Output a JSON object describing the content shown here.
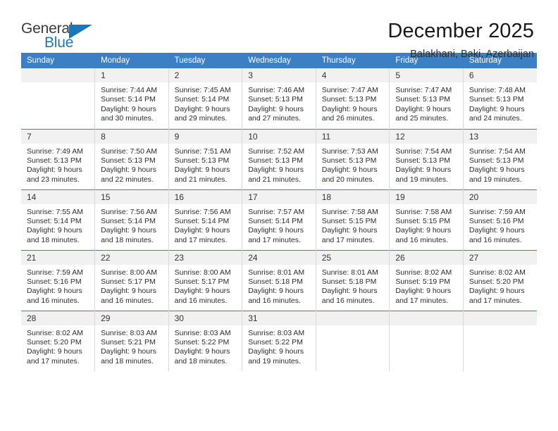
{
  "brand": {
    "name_part1": "General",
    "name_part2": "Blue",
    "logo_icon": "triangle-flag-icon",
    "accent_color": "#1b76bc"
  },
  "header": {
    "month_title": "December 2025",
    "location": "Balakhani, Baki, Azerbaijan"
  },
  "calendar": {
    "header_background": "#3b7fc4",
    "daynum_background": "#f1f1f1",
    "weekday_headers": [
      "Sunday",
      "Monday",
      "Tuesday",
      "Wednesday",
      "Thursday",
      "Friday",
      "Saturday"
    ],
    "weeks": [
      [
        {
          "day": "",
          "sunrise": "",
          "sunset": "",
          "daylight_line1": "",
          "daylight_line2": ""
        },
        {
          "day": "1",
          "sunrise": "Sunrise: 7:44 AM",
          "sunset": "Sunset: 5:14 PM",
          "daylight_line1": "Daylight: 9 hours",
          "daylight_line2": "and 30 minutes."
        },
        {
          "day": "2",
          "sunrise": "Sunrise: 7:45 AM",
          "sunset": "Sunset: 5:14 PM",
          "daylight_line1": "Daylight: 9 hours",
          "daylight_line2": "and 29 minutes."
        },
        {
          "day": "3",
          "sunrise": "Sunrise: 7:46 AM",
          "sunset": "Sunset: 5:13 PM",
          "daylight_line1": "Daylight: 9 hours",
          "daylight_line2": "and 27 minutes."
        },
        {
          "day": "4",
          "sunrise": "Sunrise: 7:47 AM",
          "sunset": "Sunset: 5:13 PM",
          "daylight_line1": "Daylight: 9 hours",
          "daylight_line2": "and 26 minutes."
        },
        {
          "day": "5",
          "sunrise": "Sunrise: 7:47 AM",
          "sunset": "Sunset: 5:13 PM",
          "daylight_line1": "Daylight: 9 hours",
          "daylight_line2": "and 25 minutes."
        },
        {
          "day": "6",
          "sunrise": "Sunrise: 7:48 AM",
          "sunset": "Sunset: 5:13 PM",
          "daylight_line1": "Daylight: 9 hours",
          "daylight_line2": "and 24 minutes."
        }
      ],
      [
        {
          "day": "7",
          "sunrise": "Sunrise: 7:49 AM",
          "sunset": "Sunset: 5:13 PM",
          "daylight_line1": "Daylight: 9 hours",
          "daylight_line2": "and 23 minutes."
        },
        {
          "day": "8",
          "sunrise": "Sunrise: 7:50 AM",
          "sunset": "Sunset: 5:13 PM",
          "daylight_line1": "Daylight: 9 hours",
          "daylight_line2": "and 22 minutes."
        },
        {
          "day": "9",
          "sunrise": "Sunrise: 7:51 AM",
          "sunset": "Sunset: 5:13 PM",
          "daylight_line1": "Daylight: 9 hours",
          "daylight_line2": "and 21 minutes."
        },
        {
          "day": "10",
          "sunrise": "Sunrise: 7:52 AM",
          "sunset": "Sunset: 5:13 PM",
          "daylight_line1": "Daylight: 9 hours",
          "daylight_line2": "and 21 minutes."
        },
        {
          "day": "11",
          "sunrise": "Sunrise: 7:53 AM",
          "sunset": "Sunset: 5:13 PM",
          "daylight_line1": "Daylight: 9 hours",
          "daylight_line2": "and 20 minutes."
        },
        {
          "day": "12",
          "sunrise": "Sunrise: 7:54 AM",
          "sunset": "Sunset: 5:13 PM",
          "daylight_line1": "Daylight: 9 hours",
          "daylight_line2": "and 19 minutes."
        },
        {
          "day": "13",
          "sunrise": "Sunrise: 7:54 AM",
          "sunset": "Sunset: 5:13 PM",
          "daylight_line1": "Daylight: 9 hours",
          "daylight_line2": "and 19 minutes."
        }
      ],
      [
        {
          "day": "14",
          "sunrise": "Sunrise: 7:55 AM",
          "sunset": "Sunset: 5:14 PM",
          "daylight_line1": "Daylight: 9 hours",
          "daylight_line2": "and 18 minutes."
        },
        {
          "day": "15",
          "sunrise": "Sunrise: 7:56 AM",
          "sunset": "Sunset: 5:14 PM",
          "daylight_line1": "Daylight: 9 hours",
          "daylight_line2": "and 18 minutes."
        },
        {
          "day": "16",
          "sunrise": "Sunrise: 7:56 AM",
          "sunset": "Sunset: 5:14 PM",
          "daylight_line1": "Daylight: 9 hours",
          "daylight_line2": "and 17 minutes."
        },
        {
          "day": "17",
          "sunrise": "Sunrise: 7:57 AM",
          "sunset": "Sunset: 5:14 PM",
          "daylight_line1": "Daylight: 9 hours",
          "daylight_line2": "and 17 minutes."
        },
        {
          "day": "18",
          "sunrise": "Sunrise: 7:58 AM",
          "sunset": "Sunset: 5:15 PM",
          "daylight_line1": "Daylight: 9 hours",
          "daylight_line2": "and 17 minutes."
        },
        {
          "day": "19",
          "sunrise": "Sunrise: 7:58 AM",
          "sunset": "Sunset: 5:15 PM",
          "daylight_line1": "Daylight: 9 hours",
          "daylight_line2": "and 16 minutes."
        },
        {
          "day": "20",
          "sunrise": "Sunrise: 7:59 AM",
          "sunset": "Sunset: 5:16 PM",
          "daylight_line1": "Daylight: 9 hours",
          "daylight_line2": "and 16 minutes."
        }
      ],
      [
        {
          "day": "21",
          "sunrise": "Sunrise: 7:59 AM",
          "sunset": "Sunset: 5:16 PM",
          "daylight_line1": "Daylight: 9 hours",
          "daylight_line2": "and 16 minutes."
        },
        {
          "day": "22",
          "sunrise": "Sunrise: 8:00 AM",
          "sunset": "Sunset: 5:17 PM",
          "daylight_line1": "Daylight: 9 hours",
          "daylight_line2": "and 16 minutes."
        },
        {
          "day": "23",
          "sunrise": "Sunrise: 8:00 AM",
          "sunset": "Sunset: 5:17 PM",
          "daylight_line1": "Daylight: 9 hours",
          "daylight_line2": "and 16 minutes."
        },
        {
          "day": "24",
          "sunrise": "Sunrise: 8:01 AM",
          "sunset": "Sunset: 5:18 PM",
          "daylight_line1": "Daylight: 9 hours",
          "daylight_line2": "and 16 minutes."
        },
        {
          "day": "25",
          "sunrise": "Sunrise: 8:01 AM",
          "sunset": "Sunset: 5:18 PM",
          "daylight_line1": "Daylight: 9 hours",
          "daylight_line2": "and 16 minutes."
        },
        {
          "day": "26",
          "sunrise": "Sunrise: 8:02 AM",
          "sunset": "Sunset: 5:19 PM",
          "daylight_line1": "Daylight: 9 hours",
          "daylight_line2": "and 17 minutes."
        },
        {
          "day": "27",
          "sunrise": "Sunrise: 8:02 AM",
          "sunset": "Sunset: 5:20 PM",
          "daylight_line1": "Daylight: 9 hours",
          "daylight_line2": "and 17 minutes."
        }
      ],
      [
        {
          "day": "28",
          "sunrise": "Sunrise: 8:02 AM",
          "sunset": "Sunset: 5:20 PM",
          "daylight_line1": "Daylight: 9 hours",
          "daylight_line2": "and 17 minutes."
        },
        {
          "day": "29",
          "sunrise": "Sunrise: 8:03 AM",
          "sunset": "Sunset: 5:21 PM",
          "daylight_line1": "Daylight: 9 hours",
          "daylight_line2": "and 18 minutes."
        },
        {
          "day": "30",
          "sunrise": "Sunrise: 8:03 AM",
          "sunset": "Sunset: 5:22 PM",
          "daylight_line1": "Daylight: 9 hours",
          "daylight_line2": "and 18 minutes."
        },
        {
          "day": "31",
          "sunrise": "Sunrise: 8:03 AM",
          "sunset": "Sunset: 5:22 PM",
          "daylight_line1": "Daylight: 9 hours",
          "daylight_line2": "and 19 minutes."
        },
        {
          "day": "",
          "sunrise": "",
          "sunset": "",
          "daylight_line1": "",
          "daylight_line2": ""
        },
        {
          "day": "",
          "sunrise": "",
          "sunset": "",
          "daylight_line1": "",
          "daylight_line2": ""
        },
        {
          "day": "",
          "sunrise": "",
          "sunset": "",
          "daylight_line1": "",
          "daylight_line2": ""
        }
      ]
    ]
  }
}
